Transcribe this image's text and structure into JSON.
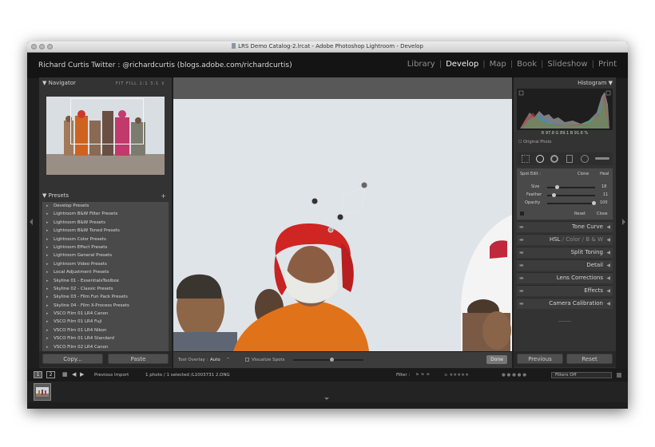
{
  "window": {
    "title": "LRS Demo Catalog-2.lrcat - Adobe Photoshop Lightroom - Develop"
  },
  "identity_plate": "Richard Curtis Twitter : @richardcurtis (blogs.adobe.com/richardcurtis)",
  "modules": [
    "Library",
    "Develop",
    "Map",
    "Book",
    "Slideshow",
    "Print"
  ],
  "active_module": "Develop",
  "navigator": {
    "title": "Navigator",
    "zoom_options": "FIT  FILL  1:1  3:1  ⇕"
  },
  "presets": {
    "title": "Presets",
    "add_symbol": "+",
    "items": [
      "Develop Presets",
      "Lightroom B&W Filter Presets",
      "Lightroom B&W Presets",
      "Lightroom B&W Toned Presets",
      "Lightroom Color Presets",
      "Lightroom Effect Presets",
      "Lightroom General Presets",
      "Lightroom Video Presets",
      "Local Adjustment Presets",
      "Skyline 01 - EssentialsToolbox",
      "Skyline 02 - Classic Presets",
      "Skyline 03 - Film Fun Pack Presets",
      "Skyline 04 - Film X-Process Presets",
      "VSCO Film 01 LR4 Canon",
      "VSCO Film 01 LR4 Fuji",
      "VSCO Film 01 LR4 Nikon",
      "VSCO Film 01 LR4 Standard",
      "VSCO Film 02 LR4 Canon"
    ]
  },
  "left_buttons": {
    "copy": "Copy...",
    "paste": "Paste"
  },
  "toolbar": {
    "tool_overlay_label": "Tool Overlay :",
    "tool_overlay_value": "Auto",
    "visualize_spots": "Visualize Spots",
    "done": "Done"
  },
  "histogram": {
    "title": "Histogram",
    "readout": "R  97.8  G  89.1  B  91.6  %",
    "original_photo": "Original Photo"
  },
  "spot_edit": {
    "label": "Spot Edit :",
    "clone": "Clone",
    "heal": "Heal",
    "size_label": "Size",
    "size_value": "18",
    "feather_label": "Feather",
    "feather_value": "11",
    "opacity_label": "Opacity",
    "opacity_value": "100",
    "reset": "Reset",
    "close": "Close"
  },
  "sections": {
    "tone_curve": "Tone Curve",
    "hsl": "HSL",
    "color": "Color",
    "bw": "B & W",
    "split_toning": "Split Toning",
    "detail": "Detail",
    "lens_corrections": "Lens Corrections",
    "effects": "Effects",
    "camera_calibration": "Camera Calibration"
  },
  "right_buttons": {
    "previous": "Previous",
    "reset": "Reset"
  },
  "filmstrip": {
    "view1": "1",
    "view2": "2",
    "source": "Previous Import",
    "selection": "1 photo / 1 selected /L1003731 2.DNG",
    "filter_label": "Filter :",
    "filters_off": "Filters Off"
  },
  "colors": {
    "panel_bg": "#333333",
    "active_text": "#f2f2f2",
    "inactive_text": "#8f8f8f"
  }
}
